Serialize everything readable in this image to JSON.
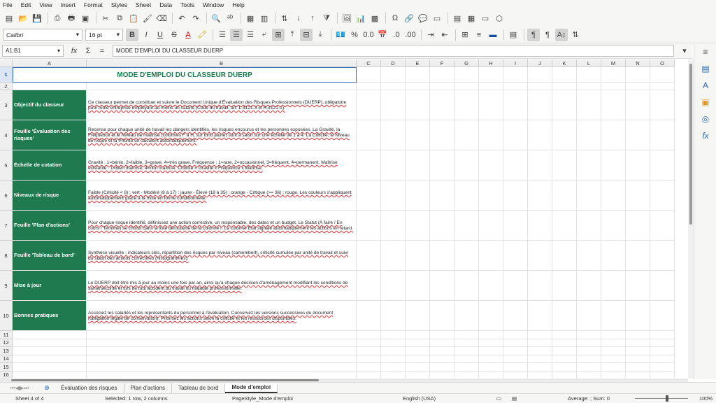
{
  "menu": [
    "File",
    "Edit",
    "View",
    "Insert",
    "Format",
    "Styles",
    "Sheet",
    "Data",
    "Tools",
    "Window",
    "Help"
  ],
  "font_name": "Calibri",
  "font_size": "16 pt",
  "name_box": "A1:B1",
  "formula": "MODE D'EMPLOI DU CLASSEUR DUERP",
  "columns": [
    "A",
    "B",
    "C",
    "D",
    "E",
    "F",
    "G",
    "H",
    "I",
    "J",
    "K",
    "L",
    "M",
    "N",
    "O"
  ],
  "title": "MODE D'EMPLOI DU CLASSEUR DUERP",
  "rows": [
    {
      "num": "3",
      "label": "Objectif du classeur",
      "text": "Ce classeur permet de constituer et suivre le Document Unique d'Évaluation des Risques Professionnels (DUERP), obligatoire pour toute entreprise employant au moins un salarié (Code du travail, art. L.4121-3 et R.4121-1)."
    },
    {
      "num": "4",
      "label": "Feuille 'Évaluation des risques'",
      "text": "Recense pour chaque unité de travail les dangers identifiés, les risques encourus et les personnes exposées. La Gravité, la Fréquence et le Niveau de maîtrise (colonnes F à H, sur fond jaune) sont à saisir sur une échelle de 1 à 4. La Criticité, le Niveau de risque et la Priorité se calculent automatiquement."
    },
    {
      "num": "5",
      "label": "Échelle de cotation",
      "text": "Gravité : 1=bénin, 2=faible, 3=grave, 4=très grave. Fréquence : 1=rare, 2=occasionnel, 3=fréquent, 4=permanent. Maîtrise existante : 1=bien maîtrisé, 4=non maîtrisé. Criticité = Gravité x Fréquence x Maîtrise."
    },
    {
      "num": "6",
      "label": "Niveaux de risque",
      "text": "Faible (Criticité < 8) : vert - Modéré (8 à 17) : jaune - Élevé (18 à 35) : orange - Critique (>= 36) : rouge. Les couleurs s'appliquent automatiquement grâce à la mise en forme conditionnelle."
    },
    {
      "num": "7",
      "label": "Feuille 'Plan d'actions'",
      "text": "Pour chaque risque identifié, définissez une action corrective, un responsable, des dates et un budget. Le Statut (À faire / En cours / Terminé) se choisit dans la liste déroulante de la colonne I. La colonne Etat signale automatiquement les actions en retard."
    },
    {
      "num": "8",
      "label": "Feuille 'Tableau de bord'",
      "text": "Synthèse visuelle : indicateurs clés, répartition des risques par niveau (camembert), criticité cumulée par unité de travail et suivi du statut des actions correctives (histogrammes)."
    },
    {
      "num": "9",
      "label": "Mise à jour",
      "text": "Le DUERP doit être mis à jour au moins une fois par an, ainsi qu'à chaque décision d'aménagement modifiant les conditions de santé/sécurité et lors de tout accident du travail ou maladie professionnelle."
    },
    {
      "num": "10",
      "label": "Bonnes pratiques",
      "text": "Associez les salariés et les représentants du personnel à l'évaluation. Conservez les versions successives du document (obligation légale de conservation). Priorisez les actions selon la criticité et les ressources disponibles."
    }
  ],
  "empty_rows": [
    "11",
    "12",
    "13",
    "14",
    "15",
    "16"
  ],
  "tabs": [
    "Évaluation des risques",
    "Plan d'actions",
    "Tableau de bord",
    "Mode d'emploi"
  ],
  "status": {
    "sheet": "Sheet 4 of 4",
    "selection": "Selected: 1 row, 2 columns",
    "style": "PageStyle_Mode d'emploi",
    "lang": "English (USA)",
    "sum": "Average: ; Sum: 0",
    "zoom": "100%"
  },
  "colors": {
    "header_green": "#1f7a4f",
    "selection_blue": "#3b6fb6"
  }
}
